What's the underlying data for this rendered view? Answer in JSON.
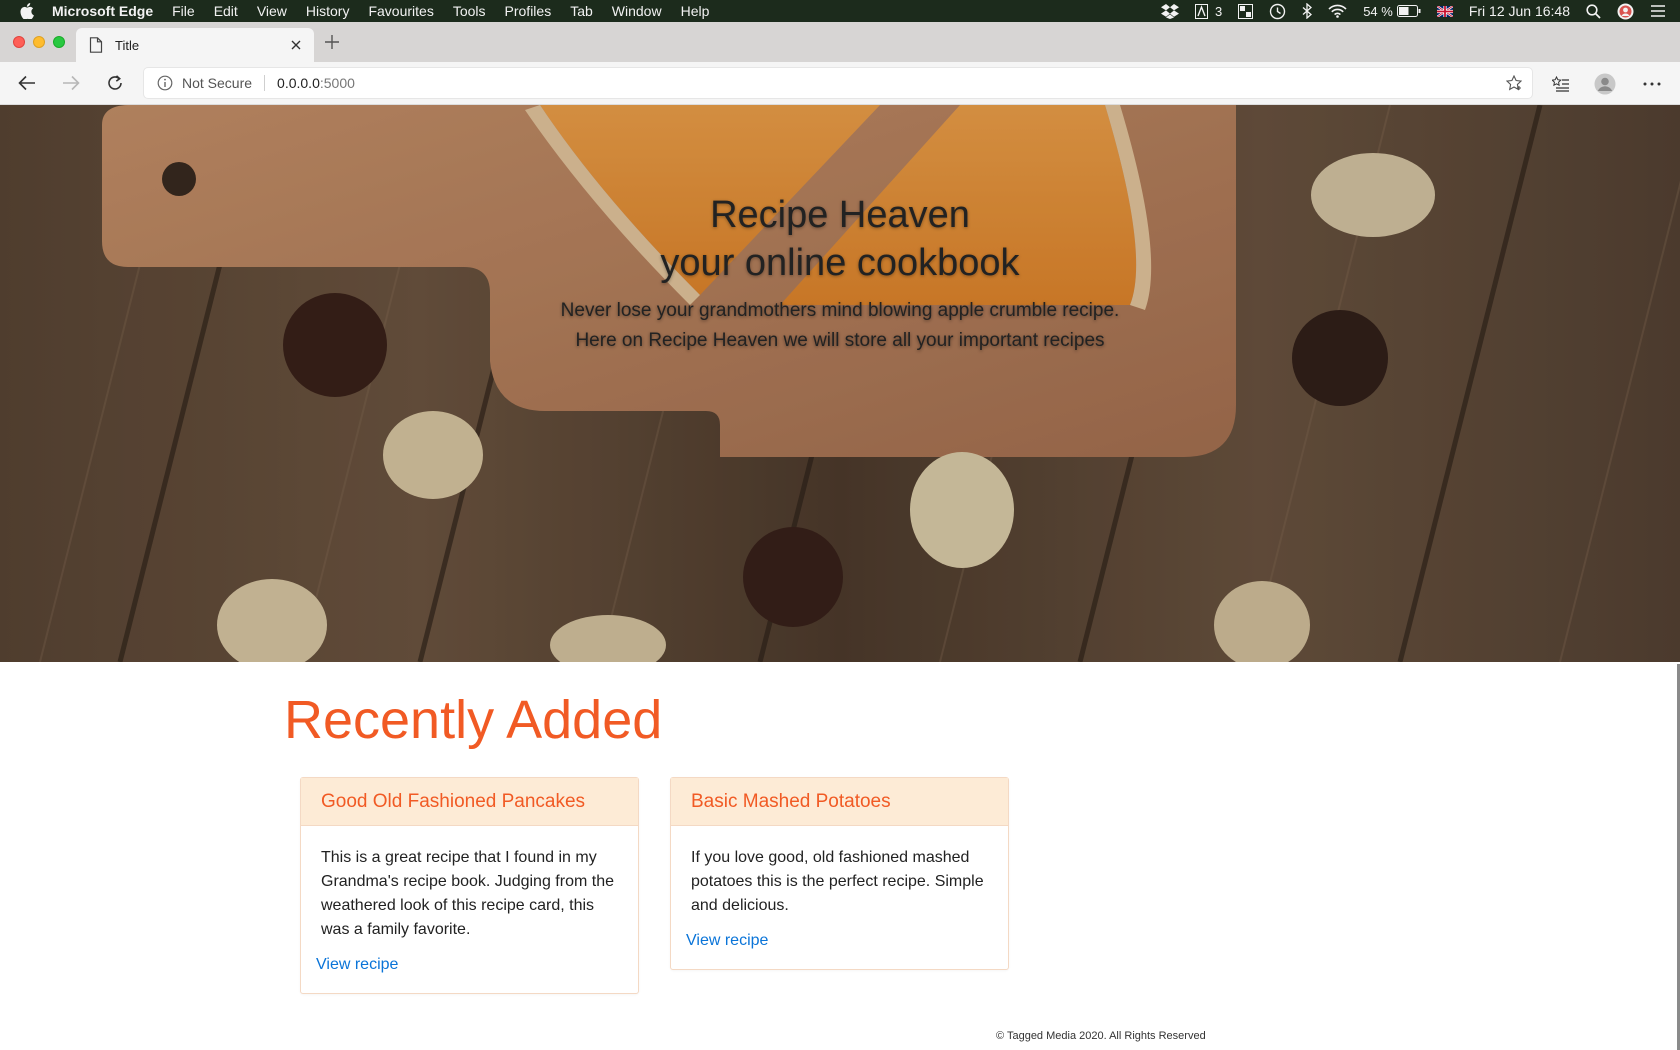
{
  "menubar": {
    "app_name": "Microsoft Edge",
    "items": [
      "File",
      "Edit",
      "View",
      "History",
      "Favourites",
      "Tools",
      "Profiles",
      "Tab",
      "Window",
      "Help"
    ],
    "status": {
      "notification_count": "3",
      "battery": "54 %",
      "clock": "Fri 12 Jun  16:48"
    }
  },
  "browser": {
    "tab_title": "Title",
    "security_label": "Not Secure",
    "url_host": "0.0.0.0",
    "url_port": ":5000"
  },
  "hero": {
    "title_line1": "Recipe Heaven",
    "title_line2": "your online cookbook",
    "subtitle_line1": "Never lose your grandmothers mind blowing apple crumble recipe.",
    "subtitle_line2": "Here on Recipe Heaven we will store all your important recipes"
  },
  "recent": {
    "heading": "Recently Added",
    "cards": [
      {
        "title": "Good Old Fashioned Pancakes",
        "description": "This is a great recipe that I found in my Grandma's recipe book. Judging from the weathered look of this recipe card, this was a family favorite.",
        "link": "View recipe"
      },
      {
        "title": "Basic Mashed Potatoes",
        "description": "If you love good, old fashioned mashed potatoes this is the perfect recipe. Simple and delicious.",
        "link": "View recipe"
      }
    ]
  },
  "footer": {
    "text": "© Tagged Media 2020. All Rights Reserved"
  },
  "colors": {
    "accent": "#f15a24",
    "link": "#0a74d8",
    "card_header_bg": "#fdebd6"
  }
}
